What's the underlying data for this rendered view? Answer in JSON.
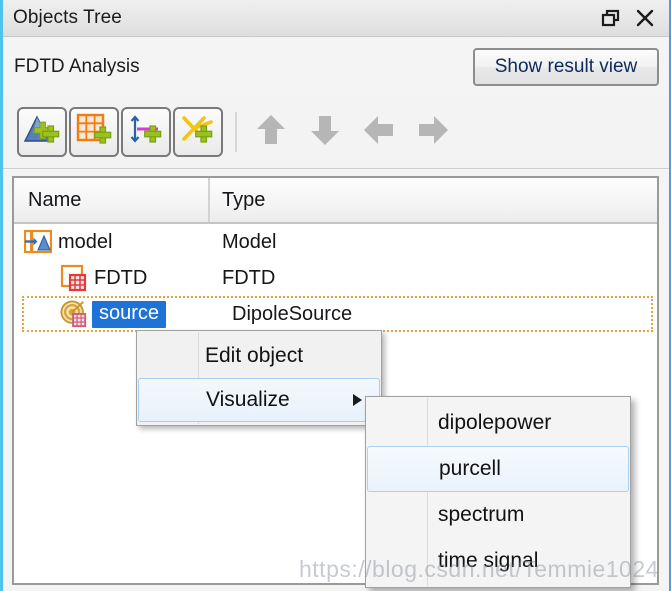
{
  "window": {
    "title": "Objects Tree",
    "float_icon": "restore-icon",
    "close_icon": "close-icon"
  },
  "subheader": {
    "label": "FDTD Analysis",
    "show_result_button": "Show result view"
  },
  "toolbar": {
    "buttons": [
      {
        "name": "add-structure",
        "icon": "triangle-plus-icon"
      },
      {
        "name": "add-mesh",
        "icon": "grid-plus-icon"
      },
      {
        "name": "add-monitor",
        "icon": "monitor-plus-icon"
      },
      {
        "name": "add-analysis",
        "icon": "cross-plus-icon"
      }
    ],
    "arrows": [
      {
        "name": "move-up",
        "icon": "arrow-up-icon"
      },
      {
        "name": "move-down",
        "icon": "arrow-down-icon"
      },
      {
        "name": "move-left",
        "icon": "arrow-left-icon"
      },
      {
        "name": "move-right",
        "icon": "arrow-right-icon"
      }
    ]
  },
  "tree": {
    "columns": {
      "name": "Name",
      "type": "Type"
    },
    "rows": [
      {
        "name": "model",
        "type": "Model",
        "icon": "model-icon",
        "selected": false
      },
      {
        "name": "FDTD",
        "type": "FDTD",
        "icon": "fdtd-icon",
        "selected": false
      },
      {
        "name": "source",
        "type": "DipoleSource",
        "icon": "dipole-icon",
        "selected": true
      }
    ]
  },
  "context_menu": {
    "items": [
      {
        "label": "Edit object",
        "highlighted": false,
        "has_submenu": false
      },
      {
        "label": "Visualize",
        "highlighted": true,
        "has_submenu": true
      }
    ]
  },
  "submenu": {
    "items": [
      {
        "label": "dipolepower",
        "highlighted": false
      },
      {
        "label": "purcell",
        "highlighted": true
      },
      {
        "label": "spectrum",
        "highlighted": false
      },
      {
        "label": "time signal",
        "highlighted": false
      }
    ]
  },
  "watermark": {
    "text": "https://blog.csdn.net/Temmie1024"
  },
  "colors": {
    "accent_border": "#4ec3f0",
    "selection_blue": "#1f72d6",
    "focus_orange": "#e8a33d",
    "highlight_blue": "#a9cdf0"
  }
}
